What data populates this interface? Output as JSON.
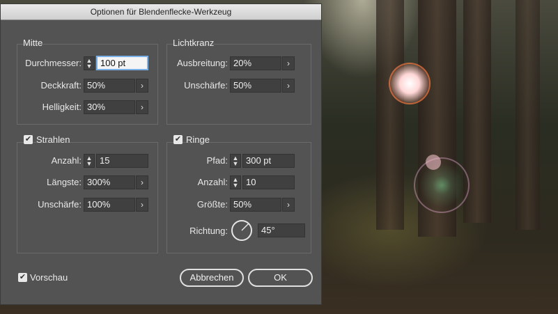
{
  "dialog": {
    "title": "Optionen für Blendenflecke-Werkzeug"
  },
  "mitte": {
    "title": "Mitte",
    "durchmesser_label": "Durchmesser:",
    "durchmesser_value": "100 pt",
    "deckkraft_label": "Deckkraft:",
    "deckkraft_value": "50%",
    "helligkeit_label": "Helligkeit:",
    "helligkeit_value": "30%"
  },
  "lichtkranz": {
    "title": "Lichtkranz",
    "ausbreitung_label": "Ausbreitung:",
    "ausbreitung_value": "20%",
    "unschaerfe_label": "Unschärfe:",
    "unschaerfe_value": "50%"
  },
  "strahlen": {
    "title": "Strahlen",
    "checked": true,
    "anzahl_label": "Anzahl:",
    "anzahl_value": "15",
    "laengste_label": "Längste:",
    "laengste_value": "300%",
    "unschaerfe_label": "Unschärfe:",
    "unschaerfe_value": "100%"
  },
  "ringe": {
    "title": "Ringe",
    "checked": true,
    "pfad_label": "Pfad:",
    "pfad_value": "300 pt",
    "anzahl_label": "Anzahl:",
    "anzahl_value": "10",
    "groesse_label": "Größte:",
    "groesse_value": "50%",
    "richtung_label": "Richtung:",
    "richtung_value": "45°"
  },
  "footer": {
    "vorschau_label": "Vorschau",
    "vorschau_checked": true,
    "cancel_label": "Abbrechen",
    "ok_label": "OK"
  },
  "icons": {
    "checkmark": "✔",
    "arrow": "›",
    "spin": "⌃⌄"
  }
}
